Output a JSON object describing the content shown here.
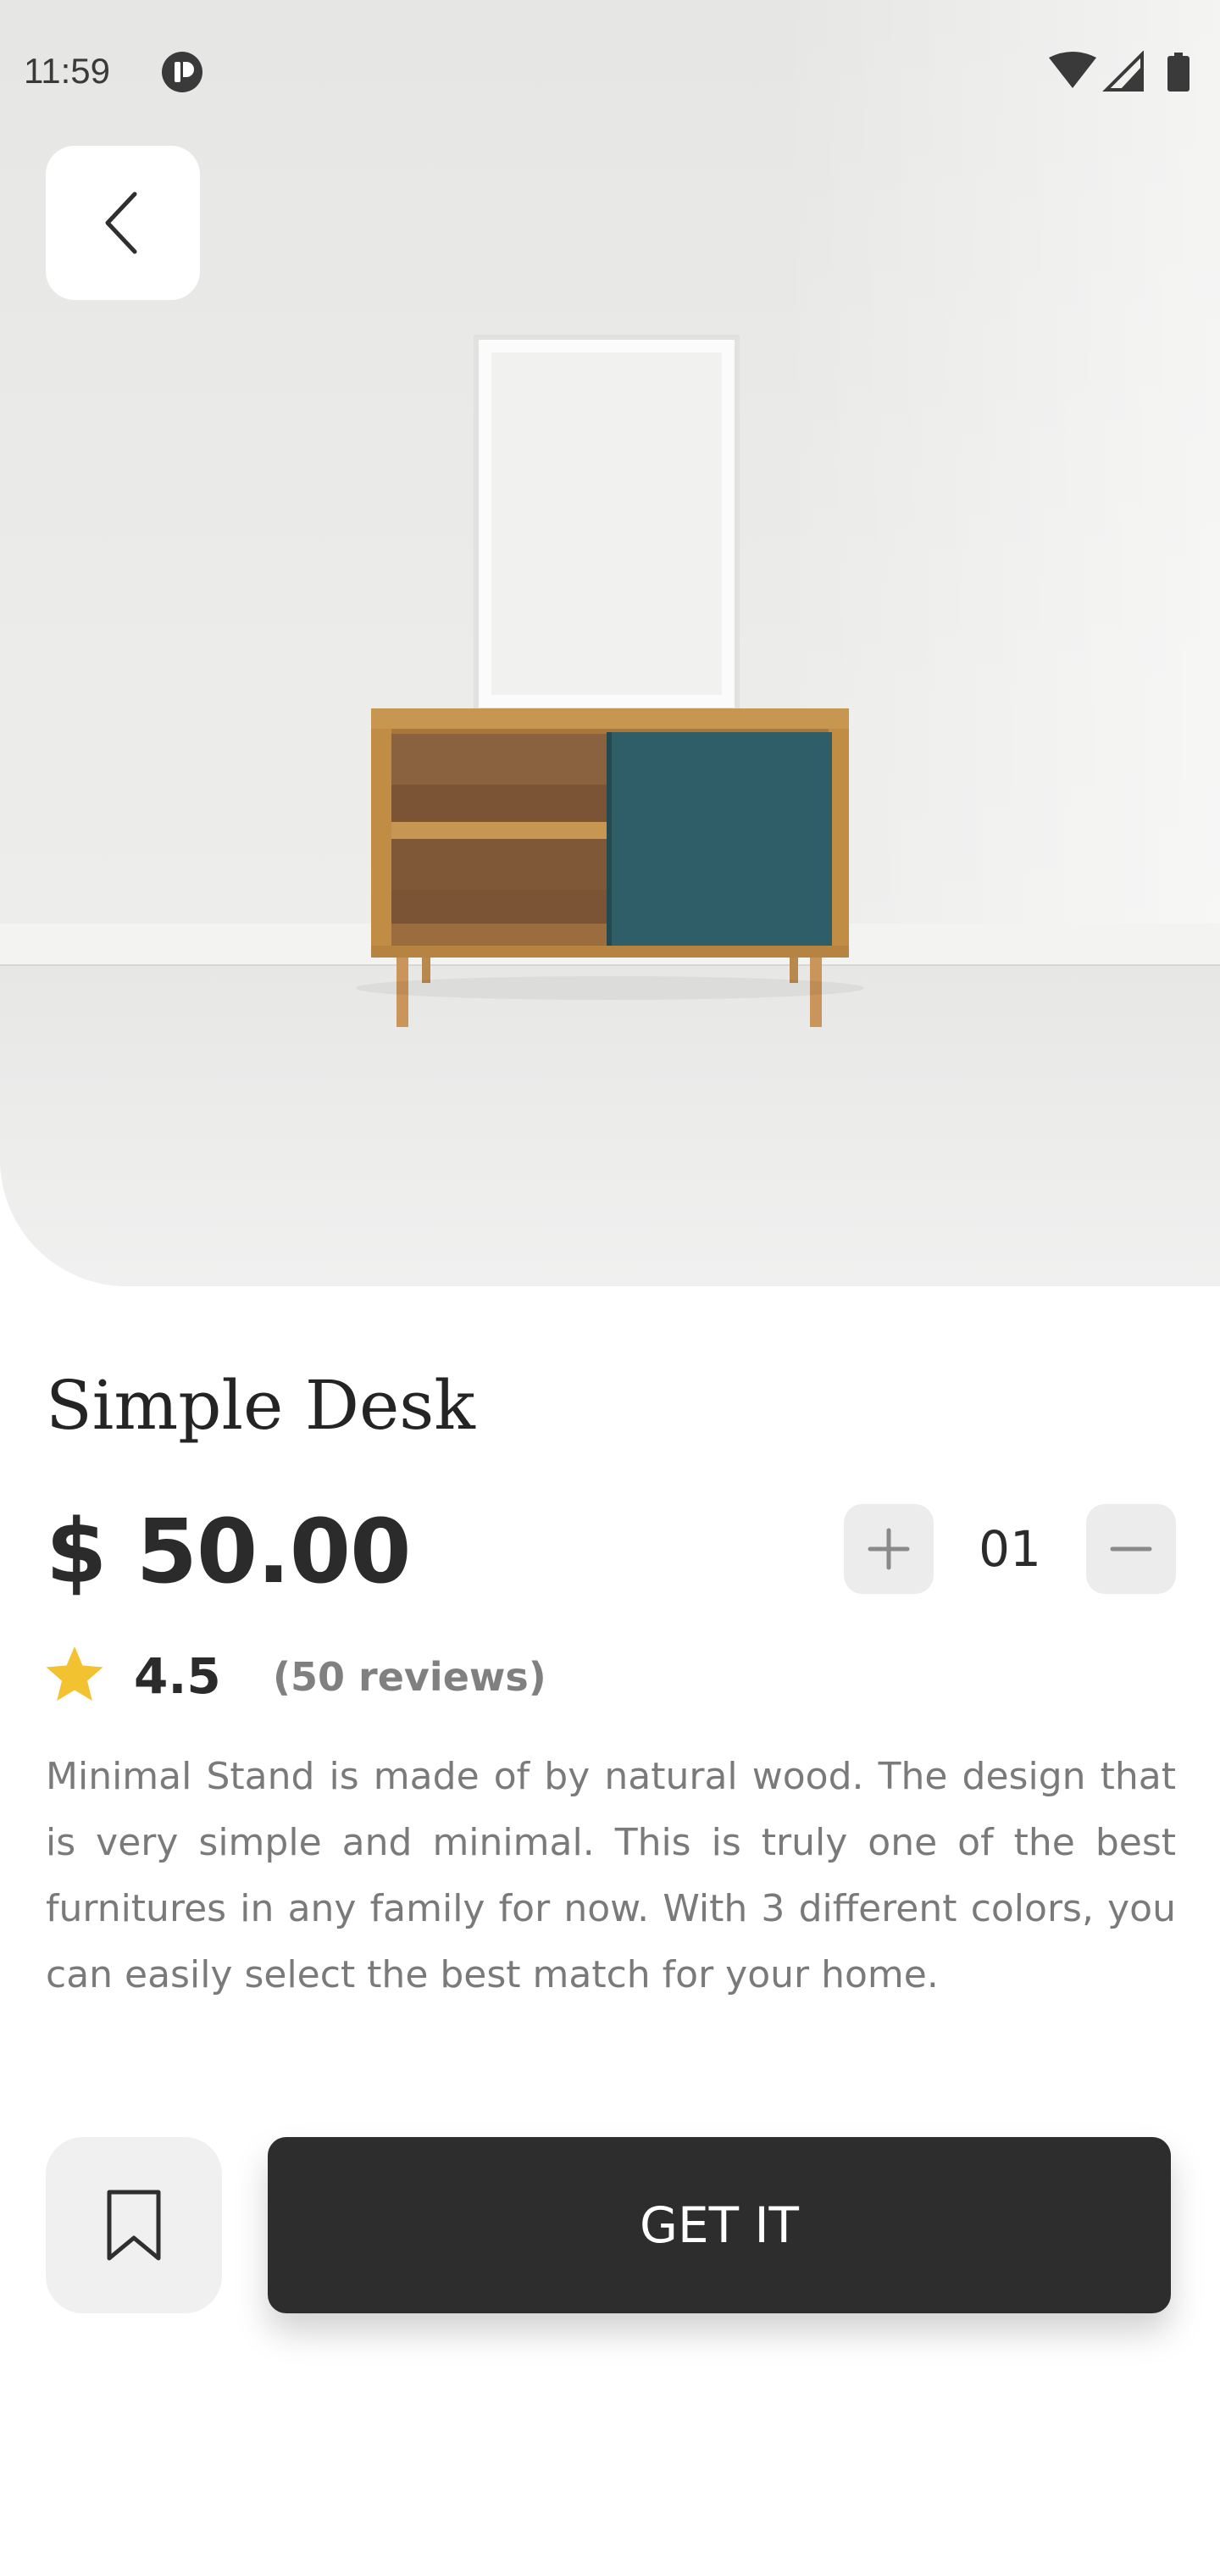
{
  "status_bar": {
    "time": "11:59",
    "icons": [
      "app-notification-icon",
      "wifi-icon",
      "signal-icon",
      "battery-icon"
    ]
  },
  "navigation": {
    "back_icon": "chevron-left-icon"
  },
  "product": {
    "title": "Simple Desk",
    "price": "$ 50.00",
    "quantity": "01",
    "rating": "4.5",
    "reviews": "(50 reviews)",
    "description": "Minimal Stand is made of by natural wood. The design that is very simple and minimal. This is truly one of the best furnitures in any family for now. With 3 different colors, you can easily select the best match for your home."
  },
  "actions": {
    "bookmark_icon": "bookmark-icon",
    "primary_label": "GET IT"
  },
  "colors": {
    "primary_button": "#2d2d2d",
    "star": "#f2c230",
    "secondary_text": "#808080",
    "qty_button_bg": "#ececec"
  }
}
